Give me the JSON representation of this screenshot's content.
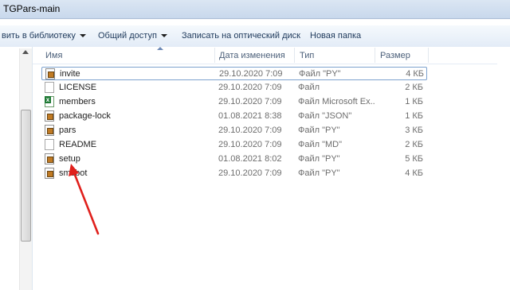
{
  "window": {
    "title": "TGPars-main"
  },
  "toolbar": {
    "library_label": "вить в библиотеку",
    "share_label": "Общий доступ",
    "burn_label": "Записать на оптический диск",
    "new_folder_label": "Новая папка"
  },
  "columns": {
    "name": "Имя",
    "date": "Дата изменения",
    "type": "Тип",
    "size": "Размер"
  },
  "files": [
    {
      "name": "invite",
      "date": "29.10.2020 7:09",
      "type": "Файл \"PY\"",
      "size": "4 КБ",
      "icon": "python-file-icon",
      "selected": true
    },
    {
      "name": "LICENSE",
      "date": "29.10.2020 7:09",
      "type": "Файл",
      "size": "2 КБ",
      "icon": "blank-file-icon"
    },
    {
      "name": "members",
      "date": "29.10.2020 7:09",
      "type": "Файл Microsoft Ex...",
      "size": "1 КБ",
      "icon": "excel-file-icon"
    },
    {
      "name": "package-lock",
      "date": "01.08.2021 8:38",
      "type": "Файл \"JSON\"",
      "size": "1 КБ",
      "icon": "python-file-icon"
    },
    {
      "name": "pars",
      "date": "29.10.2020 7:09",
      "type": "Файл \"PY\"",
      "size": "3 КБ",
      "icon": "python-file-icon"
    },
    {
      "name": "README",
      "date": "29.10.2020 7:09",
      "type": "Файл \"MD\"",
      "size": "2 КБ",
      "icon": "blank-file-icon"
    },
    {
      "name": "setup",
      "date": "01.08.2021 8:02",
      "type": "Файл \"PY\"",
      "size": "5 КБ",
      "icon": "python-file-icon"
    },
    {
      "name": "smsbot",
      "date": "29.10.2020 7:09",
      "type": "Файл \"PY\"",
      "size": "4 КБ",
      "icon": "python-file-icon"
    }
  ],
  "colors": {
    "annotation_arrow": "#e0201c",
    "selection_border": "#7da2ce"
  }
}
